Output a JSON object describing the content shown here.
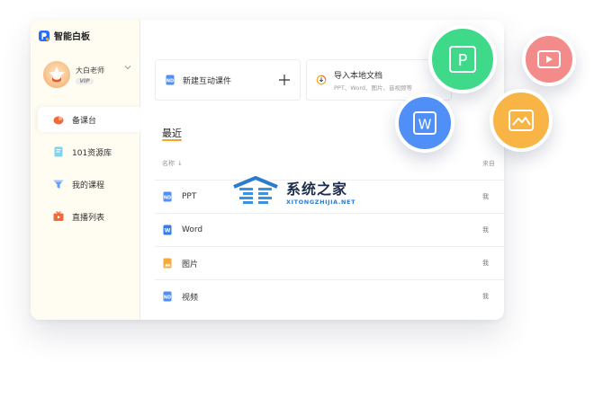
{
  "app": {
    "name": "智能白板"
  },
  "user": {
    "name": "大白老师",
    "badge": "VIP"
  },
  "sidebar": {
    "items": [
      {
        "label": "备课台",
        "active": true,
        "icon": "fire-icon"
      },
      {
        "label": "101资源库",
        "active": false,
        "icon": "book-icon"
      },
      {
        "label": "我的课程",
        "active": false,
        "icon": "funnel-icon"
      },
      {
        "label": "直播列表",
        "active": false,
        "icon": "tv-icon"
      }
    ]
  },
  "actions": {
    "new_label": "新建互动课件",
    "import_label": "导入本地文档",
    "import_sub": "PPT、Word、图片、音视频等"
  },
  "recent": {
    "title": "最近",
    "col_name": "名称",
    "col_from": "来自",
    "rows": [
      {
        "name": "PPT",
        "from": "我",
        "type": "nd"
      },
      {
        "name": "Word",
        "from": "我",
        "type": "word"
      },
      {
        "name": "图片",
        "from": "我",
        "type": "image"
      },
      {
        "name": "视频",
        "from": "我",
        "type": "nd"
      }
    ]
  },
  "bubbles": {
    "ppt_letter": "P",
    "word_letter": "W"
  },
  "watermark": {
    "cn": "系统之家",
    "en": "XITONGZHIJIA.NET"
  },
  "colors": {
    "accent": "#f5a623",
    "ppt": "#3fd98a",
    "word": "#4f8ff7",
    "image": "#f8b445",
    "video": "#f38b8b"
  }
}
